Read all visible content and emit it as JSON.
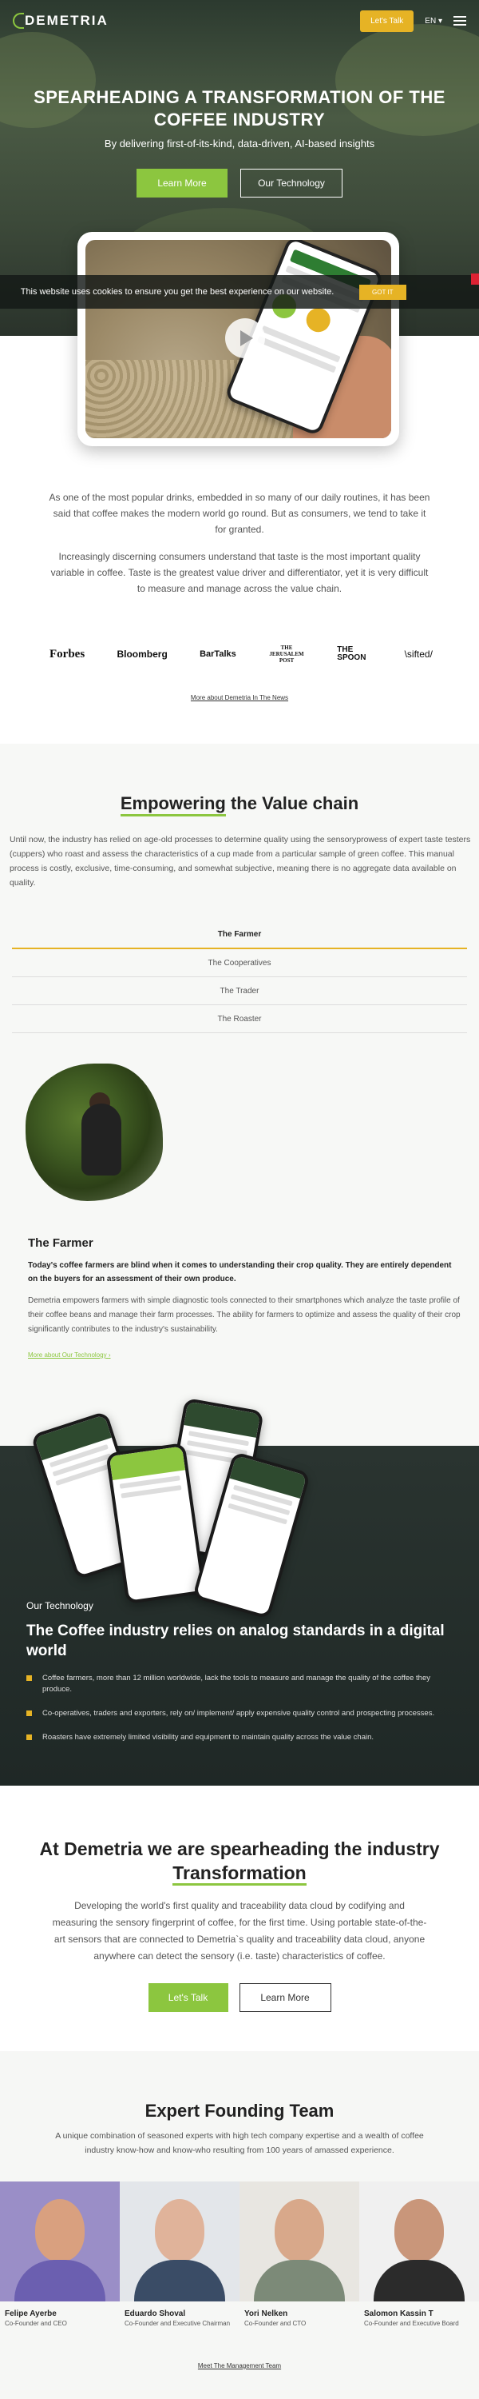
{
  "header": {
    "logo_text": "DEMETRIA",
    "cta_label": "Let's Talk",
    "language": "EN ▾"
  },
  "hero": {
    "title_line1": "SPEARHEADING A TRANSFORMATION OF THE",
    "title_line2": "COFFEE INDUSTRY",
    "subtitle": "By delivering first-of-its-kind, data-driven, AI-based insights",
    "primary_button": "Learn More",
    "secondary_button": "Our Technology"
  },
  "cookie": {
    "text": "This website uses cookies to ensure you get the best experience on our website.",
    "button": "GOT IT"
  },
  "intro": {
    "p1": "As one of the most popular drinks, embedded in so many of our daily routines, it has been said that coffee makes the modern world go round. But as consumers, we tend to take it for granted.",
    "p2": "Increasingly discerning consumers understand that taste is the most important quality variable in coffee. Taste is the greatest value driver and differentiator, yet it is very difficult to measure and manage across the value chain."
  },
  "press": {
    "logos": [
      "Forbes",
      "Bloomberg",
      "BarTalks",
      "THE JERUSALEM POST",
      "THE SPOON",
      "\\sifted/"
    ],
    "link": "More about Demetria In The News"
  },
  "empowering": {
    "title_em": "Empowering",
    "title_rest": " the Value chain",
    "description": "Until now, the industry has relied on age-old processes to determine quality using the sensoryprowess of expert taste testers (cuppers) who roast and assess the characteristics of a cup made from a particular sample of green coffee. This manual process is costly, exclusive, time-consuming, and somewhat subjective, meaning there is no aggregate data available on quality.",
    "tabs": [
      "The Farmer",
      "The Cooperatives",
      "The Trader",
      "The Roaster"
    ],
    "panel_title": "The Farmer",
    "panel_bold": "Today's coffee farmers are blind when it comes to understanding their crop quality. They are entirely dependent on the buyers for an assessment of their own produce.",
    "panel_text": "Demetria empowers farmers with simple diagnostic tools connected to their smartphones which analyze the taste profile of their coffee beans and manage their farm processes. The ability for farmers to optimize and assess the quality of their crop significantly contributes to the industry's sustainability.",
    "panel_link": "More about Our Technology"
  },
  "technology": {
    "kicker": "Our Technology",
    "title": "The Coffee industry relies on analog standards in a digital world",
    "points": [
      "Coffee farmers, more than 12 million worldwide, lack the tools to measure and manage the quality of the coffee they produce.",
      "Co-operatives, traders and exporters, rely on/ implement/ apply expensive quality control and prospecting processes.",
      "Roasters have extremely limited visibility and equipment to maintain quality across the value chain."
    ]
  },
  "transformation": {
    "title_pre": "At ",
    "title_brand": "Demetria",
    "title_mid": " we are spearheading the industry ",
    "title_em": "Transformation",
    "text": "Developing the world's first quality and traceability data cloud by codifying and measuring the sensory fingerprint of coffee, for the first time. Using portable state-of-the-art sensors that are connected to Demetria`s quality and traceability data cloud, anyone anywhere can detect the sensory (i.e. taste) characteristics of coffee.",
    "primary_button": "Let's Talk",
    "secondary_button": "Learn More"
  },
  "team": {
    "title": "Expert Founding Team",
    "description": "A unique combination of seasoned experts with high tech company expertise and a wealth of coffee industry know-how and know-who resulting from 100 years of amassed experience.",
    "members": [
      {
        "name": "Felipe Ayerbe",
        "role": "Co-Founder and CEO"
      },
      {
        "name": "Eduardo Shoval",
        "role": "Co-Founder and Executive Chairman"
      },
      {
        "name": "Yori Nelken",
        "role": "Co-Founder and CTO"
      },
      {
        "name": "Salomon Kassin T",
        "role": "Co-Founder and Executive Board"
      }
    ],
    "link": "Meet The Management Team"
  },
  "colors": {
    "accent_green": "#8cc63f",
    "accent_gold": "#e6b325",
    "dark_section": "#1f2826"
  }
}
